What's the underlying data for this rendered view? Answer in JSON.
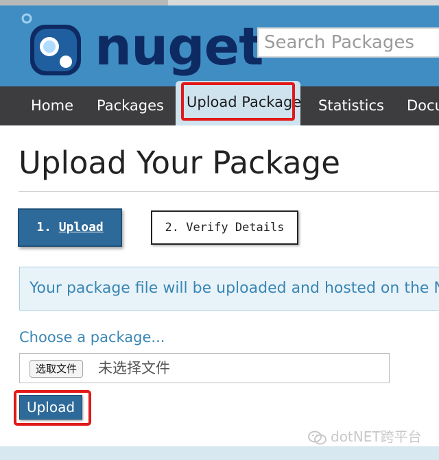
{
  "header": {
    "logo_text": "nuget",
    "search_placeholder": "Search Packages"
  },
  "nav": {
    "items": [
      "Home",
      "Packages",
      "Upload Package",
      "Statistics",
      "Docu"
    ],
    "active": "Upload Package"
  },
  "page": {
    "title": "Upload Your Package",
    "step1_num": "1.",
    "step1_label": "Upload",
    "step2_label": "2. Verify Details",
    "info_text": "Your package file will be uploaded and hosted on the N",
    "choose_label": "Choose a package...",
    "file_button_label": "选取文件",
    "file_status": "未选择文件",
    "upload_button_label": "Upload"
  },
  "watermark": {
    "text": "dotNET跨平台"
  },
  "colors": {
    "header_bg": "#3f8dc3",
    "nav_bg": "#3d3d3f",
    "active_tab_bg": "#cfe3ef",
    "highlight_red": "#e11919",
    "primary_button": "#2e6a99",
    "info_text": "#3a86b4"
  }
}
